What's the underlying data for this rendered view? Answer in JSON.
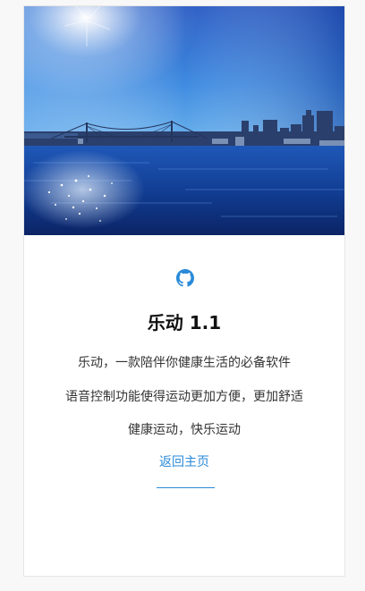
{
  "app": {
    "title": "乐动 1.1",
    "line1": "乐动，一款陪伴你健康生活的必备软件",
    "line2": "语音控制功能使得运动更加方便，更加舒适",
    "line3": "健康运动，快乐运动",
    "back_link": "返回主页",
    "icon": "github-icon"
  },
  "colors": {
    "accent": "#2a8ad9",
    "text": "#333333",
    "heading": "#111111",
    "background": "#f8f8f8"
  }
}
